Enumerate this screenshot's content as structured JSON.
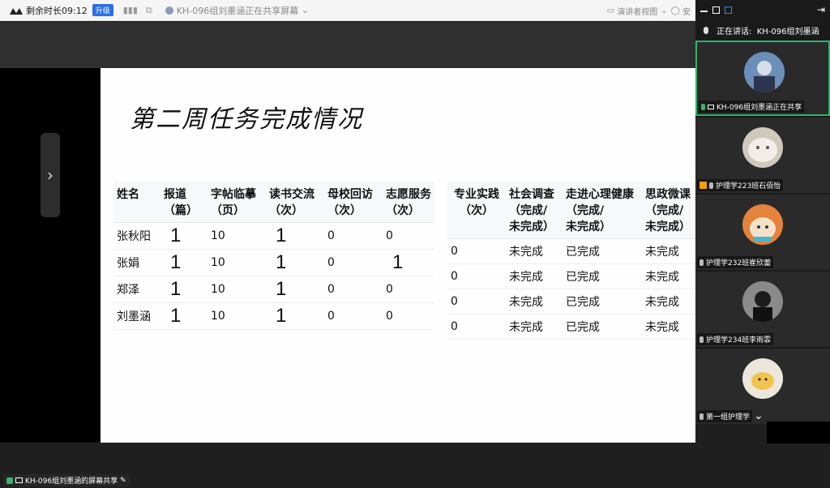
{
  "topbar": {
    "timer": "剩余时长09:12",
    "upgrade": "升级",
    "sharing_text": "KH-096组刘墨涵正在共享屏幕",
    "view_mode": "演讲者视图",
    "security": "安"
  },
  "slide": {
    "title": "第二周任务完成情况",
    "table1": {
      "headers": [
        "姓名",
        "报道\n（篇）",
        "字帖临摹\n（页）",
        "读书交流\n（次）",
        "母校回访\n（次）",
        "志愿服务\n（次）"
      ],
      "rows": [
        [
          "张秋阳",
          "1",
          "10",
          "1",
          "0",
          "0"
        ],
        [
          "张娟",
          "1",
          "10",
          "1",
          "0",
          "1"
        ],
        [
          "郑泽",
          "1",
          "10",
          "1",
          "0",
          "0"
        ],
        [
          "刘墨涵",
          "1",
          "10",
          "1",
          "0",
          "0"
        ]
      ]
    },
    "table2": {
      "headers": [
        "专业实践\n（次）",
        "社会调查\n（完成/\n未完成）",
        "走进心理健康\n（完成/\n未完成）",
        "思政微课\n（完成/\n未完成）"
      ],
      "rows": [
        [
          "0",
          "未完成",
          "已完成",
          "未完成"
        ],
        [
          "0",
          "未完成",
          "已完成",
          "未完成"
        ],
        [
          "0",
          "未完成",
          "已完成",
          "未完成"
        ],
        [
          "0",
          "未完成",
          "已完成",
          "未完成"
        ]
      ]
    }
  },
  "panel": {
    "speaking_label": "正在讲话:",
    "speaking_name": "KH-096组刘墨涵",
    "participants": [
      {
        "label": "KH-096组刘墨涵正在共享",
        "status": "sharing"
      },
      {
        "label": "护理学223班石佰怡",
        "status": "host"
      },
      {
        "label": "护理学232班崔欣蕾",
        "status": "muted"
      },
      {
        "label": "护理学234班李雨霏",
        "status": "muted"
      },
      {
        "label": "第一组护理学",
        "status": "muted"
      }
    ]
  },
  "share_badge": "KH-096组刘墨涵的屏幕共享",
  "colors": {
    "accent": "#2fb36b",
    "upgrade": "#2b6fe6"
  }
}
